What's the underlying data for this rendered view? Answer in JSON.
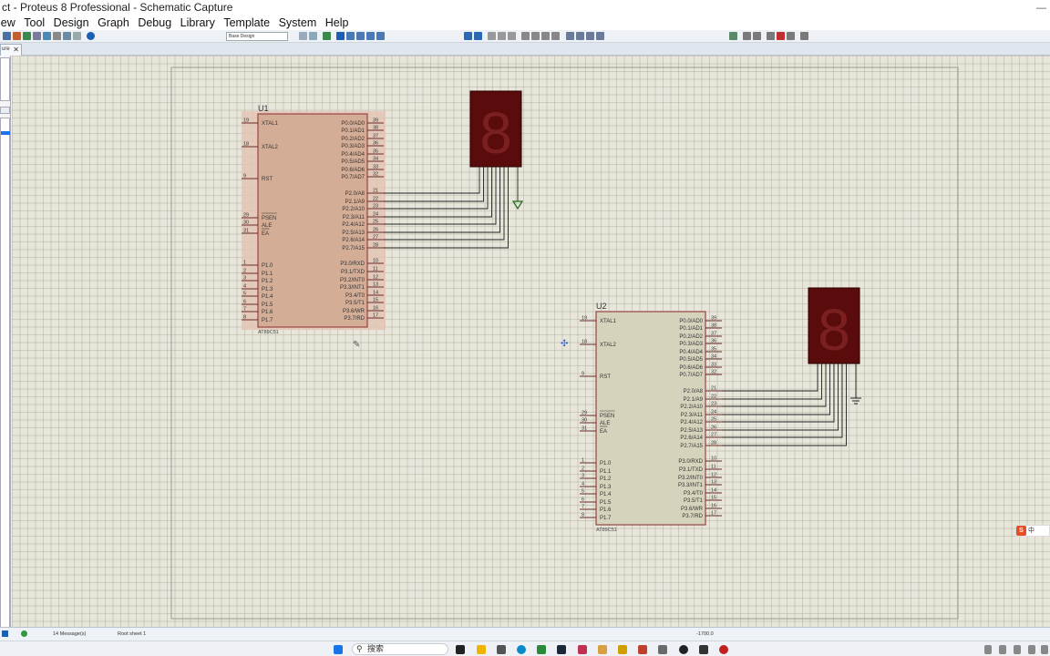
{
  "window": {
    "title": "ct - Proteus 8 Professional - Schematic Capture"
  },
  "menu": [
    "iew",
    "Tool",
    "Design",
    "Graph",
    "Debug",
    "Library",
    "Template",
    "System",
    "Help"
  ],
  "toolbar": {
    "variant_select": "Base Design"
  },
  "tabs": [
    {
      "label": "ure"
    }
  ],
  "schematic": {
    "ref1": "U1",
    "ref2": "U2",
    "part_name": "AT89C51",
    "left_pins": [
      {
        "num": "19",
        "label": "XTAL1"
      },
      {
        "num": "18",
        "label": "XTAL2"
      },
      {
        "num": "9",
        "label": "RST"
      },
      {
        "num": "29",
        "label": "PSEN"
      },
      {
        "num": "30",
        "label": "ALE"
      },
      {
        "num": "31",
        "label": "EA"
      },
      {
        "num": "1",
        "label": "P1.0"
      },
      {
        "num": "2",
        "label": "P1.1"
      },
      {
        "num": "3",
        "label": "P1.2"
      },
      {
        "num": "4",
        "label": "P1.3"
      },
      {
        "num": "5",
        "label": "P1.4"
      },
      {
        "num": "6",
        "label": "P1.5"
      },
      {
        "num": "7",
        "label": "P1.6"
      },
      {
        "num": "8",
        "label": "P1.7"
      }
    ],
    "right_pins": [
      {
        "num": "39",
        "label": "P0.0/AD0"
      },
      {
        "num": "38",
        "label": "P0.1/AD1"
      },
      {
        "num": "37",
        "label": "P0.2/AD2"
      },
      {
        "num": "36",
        "label": "P0.3/AD3"
      },
      {
        "num": "35",
        "label": "P0.4/AD4"
      },
      {
        "num": "34",
        "label": "P0.5/AD5"
      },
      {
        "num": "33",
        "label": "P0.6/AD6"
      },
      {
        "num": "32",
        "label": "P0.7/AD7"
      },
      {
        "num": "21",
        "label": "P2.0/A8"
      },
      {
        "num": "22",
        "label": "P2.1/A9"
      },
      {
        "num": "23",
        "label": "P2.2/A10"
      },
      {
        "num": "24",
        "label": "P2.3/A11"
      },
      {
        "num": "25",
        "label": "P2.4/A12"
      },
      {
        "num": "26",
        "label": "P2.5/A13"
      },
      {
        "num": "27",
        "label": "P2.6/A14"
      },
      {
        "num": "28",
        "label": "P2.7/A15"
      },
      {
        "num": "10",
        "label": "P3.0/RXD"
      },
      {
        "num": "11",
        "label": "P3.1/TXD"
      },
      {
        "num": "12",
        "label": "P3.2/INT0"
      },
      {
        "num": "13",
        "label": "P3.3/INT1"
      },
      {
        "num": "14",
        "label": "P3.4/T0"
      },
      {
        "num": "15",
        "label": "P3.5/T1"
      },
      {
        "num": "16",
        "label": "P3.6/WR"
      },
      {
        "num": "17",
        "label": "P3.7/RD"
      }
    ],
    "digit_glyph": "8"
  },
  "status": {
    "messages": "14 Message(s)",
    "sheet": "Root sheet 1",
    "coord": "-1700.0"
  },
  "taskbar": {
    "search_label": "搜索"
  },
  "ime": {
    "label": "中"
  },
  "colors": {
    "chip_selected": "#d4ad96",
    "chip_normal": "#d6d3bc",
    "chip_border": "#9a4444",
    "digit_body": "#5a0b0b",
    "wire": "#202020"
  }
}
